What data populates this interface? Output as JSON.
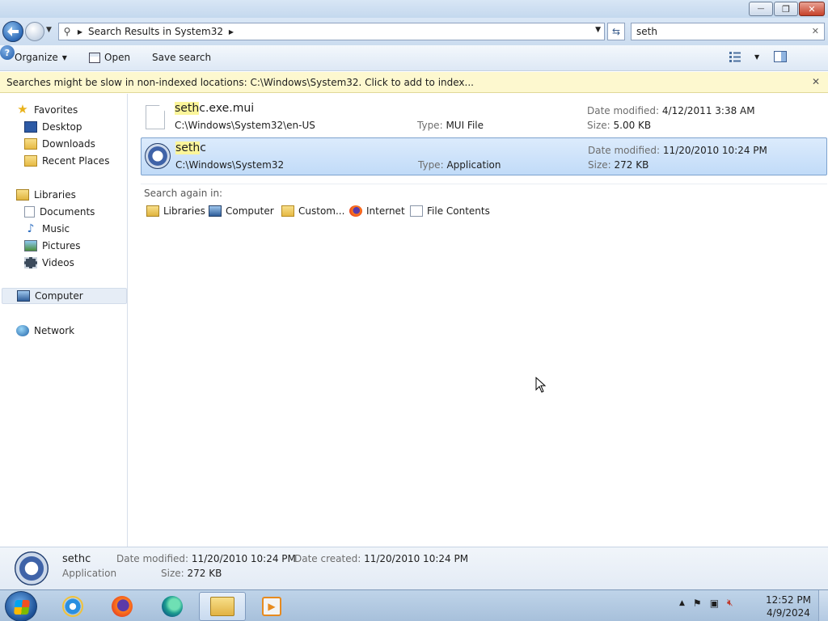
{
  "window": {
    "controls": {
      "minimize": "—",
      "maximize": "❐",
      "close": "✕"
    }
  },
  "address": {
    "breadcrumb": "Search Results in System32",
    "search_value": "seth",
    "clear_glyph": "✕"
  },
  "toolbar": {
    "organize_label": "Organize",
    "open_label": "Open",
    "save_search_label": "Save search",
    "help_glyph": "?"
  },
  "infobar": {
    "message": "Searches might be slow in non-indexed locations: C:\\Windows\\System32. Click to add to index...",
    "close_glyph": "✕"
  },
  "navpane": {
    "favorites": {
      "label": "Favorites",
      "items": [
        "Desktop",
        "Downloads",
        "Recent Places"
      ]
    },
    "libraries": {
      "label": "Libraries",
      "items": [
        "Documents",
        "Music",
        "Pictures",
        "Videos"
      ]
    },
    "computer": "Computer",
    "network": "Network"
  },
  "results": [
    {
      "name_match": "seth",
      "name_rest": "c.exe.mui",
      "path": "C:\\Windows\\System32\\en-US",
      "type_label": "Type:",
      "type": "MUI File",
      "date_label": "Date modified:",
      "date": "4/12/2011 3:38 AM",
      "size_label": "Size:",
      "size": "5.00 KB",
      "icon": "document-icon"
    },
    {
      "name_match": "seth",
      "name_rest": "c",
      "path": "C:\\Windows\\System32",
      "type_label": "Type:",
      "type": "Application",
      "date_label": "Date modified:",
      "date": "11/20/2010 10:24 PM",
      "size_label": "Size:",
      "size": "272 KB",
      "icon": "application-icon"
    }
  ],
  "search_again": {
    "label": "Search again in:",
    "options": [
      "Libraries",
      "Computer",
      "Custom...",
      "Internet",
      "File Contents"
    ]
  },
  "details": {
    "name": "sethc",
    "kind": "Application",
    "date_modified_label": "Date modified:",
    "date_modified": "11/20/2010 10:24 PM",
    "date_created_label": "Date created:",
    "date_created": "11/20/2010 10:24 PM",
    "size_label": "Size:",
    "size": "272 KB"
  },
  "taskbar": {
    "apps": [
      "internet-explorer-icon",
      "firefox-icon",
      "edge-icon",
      "windows-explorer-icon",
      "media-player-icon"
    ],
    "clock_time": "12:52 PM",
    "clock_date": "4/9/2024"
  },
  "colors": {
    "selection": "#c1dbf8",
    "highlight": "#fbf59a",
    "infobar": "#fdf8cf"
  }
}
